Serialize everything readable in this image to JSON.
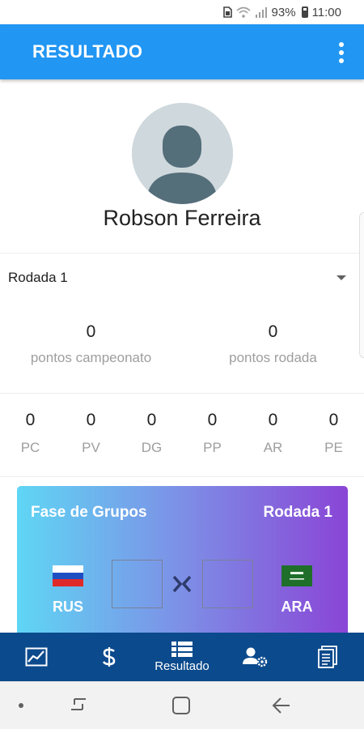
{
  "status_bar": {
    "battery": "93%",
    "time": "11:00",
    "icons": [
      "sim-icon",
      "wifi-icon",
      "signal-icon",
      "battery-icon"
    ]
  },
  "app_bar": {
    "title": "RESULTADO",
    "menu_icon": "more-vert-icon",
    "color": "#2196f3"
  },
  "profile": {
    "name": "Robson Ferreira",
    "avatar_icon": "person-icon"
  },
  "round_select": {
    "selected": "Rodada 1"
  },
  "points": [
    {
      "value": "0",
      "label": "pontos campeonato"
    },
    {
      "value": "0",
      "label": "pontos rodada"
    }
  ],
  "stats": [
    {
      "value": "0",
      "label": "PC"
    },
    {
      "value": "0",
      "label": "PV"
    },
    {
      "value": "0",
      "label": "DG"
    },
    {
      "value": "0",
      "label": "PP"
    },
    {
      "value": "0",
      "label": "AR"
    },
    {
      "value": "0",
      "label": "PE"
    }
  ],
  "match_card": {
    "phase": "Fase de Grupos",
    "round": "Rodada 1",
    "home": {
      "code": "RUS",
      "flag": "russia-flag-icon",
      "score": ""
    },
    "away": {
      "code": "ARA",
      "flag": "saudi-arabia-flag-icon",
      "score": ""
    },
    "gradient": [
      "#5fd6f4",
      "#8a45d6"
    ]
  },
  "bottom_nav": {
    "color": "#0b4a8c",
    "items": [
      {
        "icon": "chart-icon",
        "label": ""
      },
      {
        "icon": "dollar-icon",
        "label": ""
      },
      {
        "icon": "list-icon",
        "label": "Resultado"
      },
      {
        "icon": "user-settings-icon",
        "label": ""
      },
      {
        "icon": "document-icon",
        "label": ""
      }
    ]
  }
}
